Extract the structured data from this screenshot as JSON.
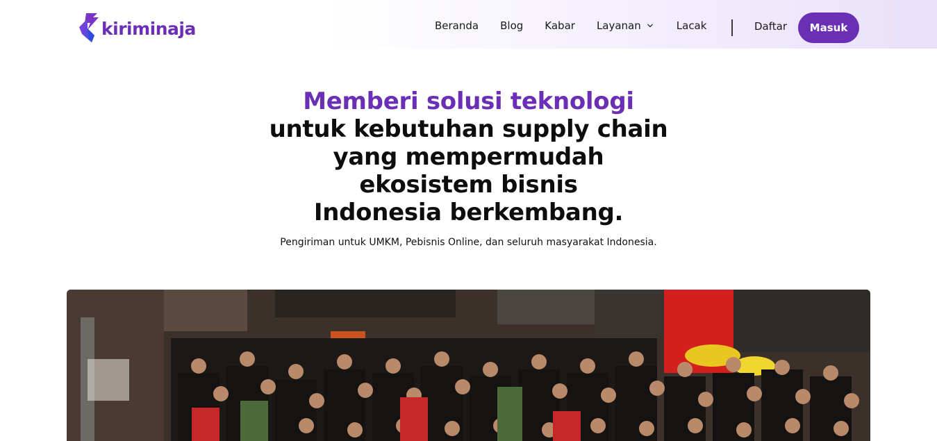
{
  "brand": {
    "name": "kiriminaja",
    "accent": "#6a2fb5"
  },
  "nav": {
    "links": [
      "Beranda",
      "Blog",
      "Kabar"
    ],
    "dropdown": {
      "label": "Layanan",
      "icon": "chevron-down-icon"
    },
    "last_link": "Lacak",
    "register": "Daftar",
    "login": "Masuk"
  },
  "hero": {
    "title_lines": [
      "Memberi solusi teknologi",
      "untuk kebutuhan supply chain",
      "yang mempermudah",
      "ekosistem bisnis",
      "Indonesia berkembang."
    ],
    "subtitle": "Pengiriman untuk UMKM, Pebisnis Online, dan seluruh masyarakat Indonesia."
  }
}
